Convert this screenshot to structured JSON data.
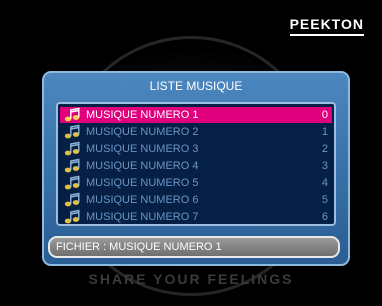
{
  "brand": {
    "logo_text": "PEEKTON"
  },
  "panel": {
    "title": "LISTE MUSIQUE",
    "items": [
      {
        "label": "MUSIQUE NUMERO 1",
        "number": "0",
        "selected": true
      },
      {
        "label": "MUSIQUE NUMERO 2",
        "number": "1",
        "selected": false
      },
      {
        "label": "MUSIQUE NUMERO 3",
        "number": "2",
        "selected": false
      },
      {
        "label": "MUSIQUE NUMERO 4",
        "number": "3",
        "selected": false
      },
      {
        "label": "MUSIQUE NUMERO 5",
        "number": "4",
        "selected": false
      },
      {
        "label": "MUSIQUE NUMERO 6",
        "number": "5",
        "selected": false
      },
      {
        "label": "MUSIQUE NUMERO 7",
        "number": "6",
        "selected": false
      }
    ],
    "file_status": "FICHIER : MUSIQUE NUMERO 1"
  },
  "tagline": "SHARE YOUR FEELINGS",
  "icons": {
    "row_icon": "music-note-icon"
  },
  "colors": {
    "selection": "#e0007d",
    "panel": "#3a74ad",
    "list_background": "#061f44",
    "item_text": "#6a95c5"
  }
}
